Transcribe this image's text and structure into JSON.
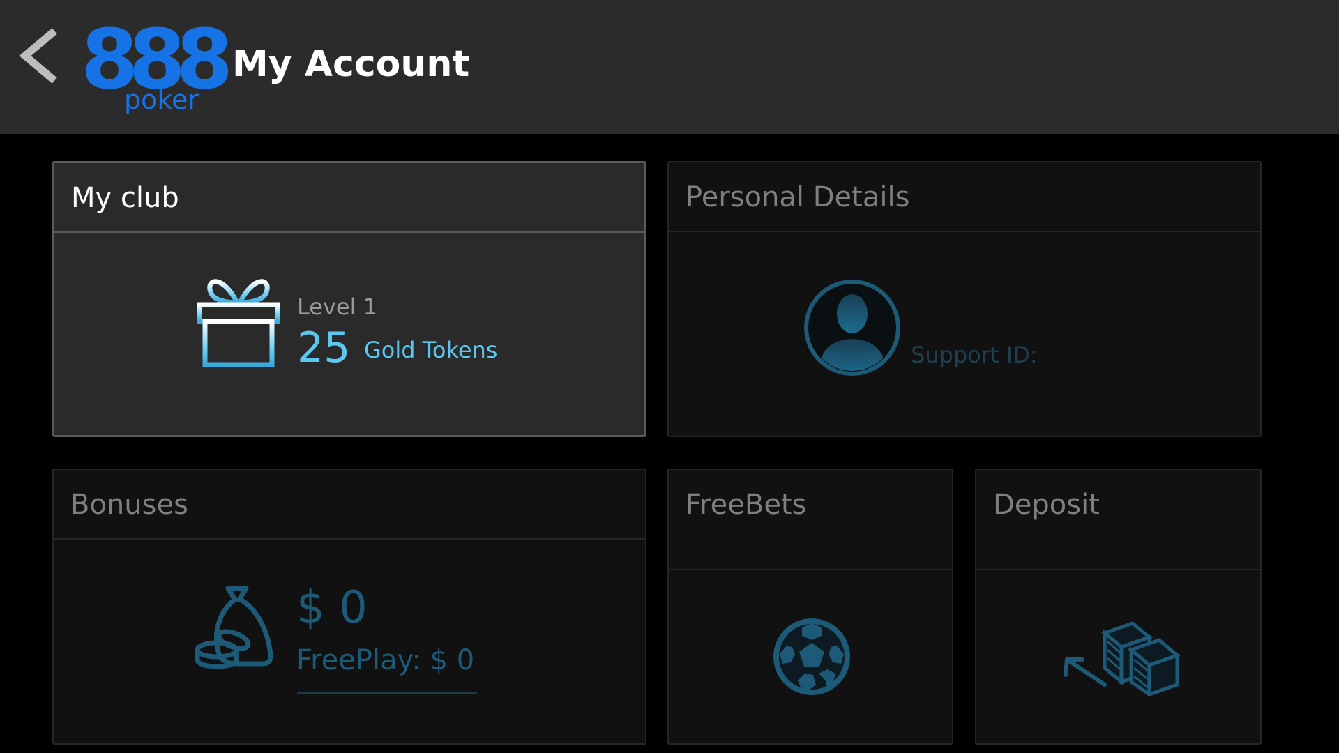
{
  "header": {
    "title": "My Account",
    "logo_number": "888",
    "logo_word": "poker",
    "back_icon": "chevron-left-icon"
  },
  "colors": {
    "header_bg": "#2b2b2b",
    "brand_blue": "#1673e6",
    "accent_cyan": "#5cc8f0",
    "dim_blue": "#1d5a78",
    "card_bg": "#111111",
    "active_card_bg": "#2a2a2a"
  },
  "cards": {
    "my_club": {
      "title": "My club",
      "level_text": "Level 1",
      "tokens_value": "25",
      "tokens_label": "Gold Tokens",
      "icon": "gift-icon"
    },
    "personal_details": {
      "title": "Personal Details",
      "support_label": "Support ID:",
      "icon": "user-avatar-icon"
    },
    "bonuses": {
      "title": "Bonuses",
      "amount": "$ 0",
      "freeplay": "FreePlay: $ 0",
      "icon": "money-bag-icon"
    },
    "freebets": {
      "title": "FreeBets",
      "icon": "soccer-ball-icon"
    },
    "deposit": {
      "title": "Deposit",
      "icon": "cash-stack-icon"
    }
  }
}
